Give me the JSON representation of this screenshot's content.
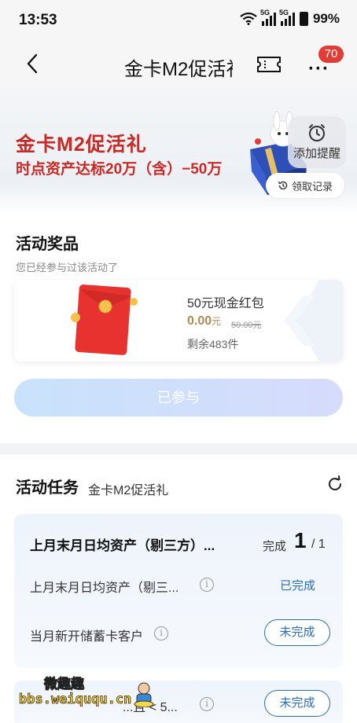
{
  "status_bar": {
    "time": "13:53",
    "network_label": "5G",
    "battery": "99%"
  },
  "nav": {
    "title": "金卡M2促活礼",
    "message_badge": "70"
  },
  "banner": {
    "title": "金卡M2促活礼",
    "subtitle": "时点资产达标20万（含）−50万",
    "remind_label": "添加提醒",
    "records_label": "领取记录"
  },
  "prize_section": {
    "title": "活动奖品",
    "subtitle": "您已经参与过该活动了",
    "prize": {
      "name": "50元现金红包",
      "price": "0.00",
      "price_unit": "元",
      "original_price": "50.00元",
      "stock": "剩余483件"
    },
    "action_label": "已参与"
  },
  "task_section": {
    "title": "活动任务",
    "activity_name": "金卡M2促活礼",
    "card": {
      "heading": "上月末月日均资产（剔三方）...",
      "progress_label": "完成",
      "progress_done": "1",
      "progress_total": "/ 1",
      "rows": [
        {
          "label": "上月末月日均资产（剔三...",
          "status": "已完成"
        },
        {
          "label": "当月新开储蓄卡客户",
          "status": "未完成"
        }
      ]
    },
    "card2": {
      "label": "...且 < 5...",
      "status": "未完成"
    }
  },
  "watermark": {
    "title": "微趣趣",
    "url": "bbs.weiququ.cn"
  },
  "colors": {
    "brand_red": "#c82a25",
    "badge_red": "#e23c36",
    "link_blue": "#2a6db5",
    "price_gold": "#b08a54"
  }
}
